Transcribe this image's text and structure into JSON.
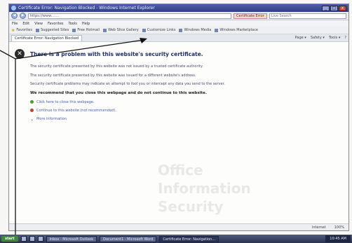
{
  "window": {
    "title": "Certificate Error: Navigation Blocked - Windows Internet Explorer",
    "buttons": {
      "minimize": "_",
      "maximize": "□",
      "close": "x"
    }
  },
  "addressbar": {
    "url": "https://www.……",
    "cert_error": "Certificate Error",
    "search_placeholder": "Live Search"
  },
  "menubar": [
    "File",
    "Edit",
    "View",
    "Favorites",
    "Tools",
    "Help"
  ],
  "favorites_bar": {
    "favorites_label": "Favorites",
    "items": [
      "Suggested Sites",
      "Free Hotmail",
      "Web Slice Gallery",
      "Customize Links",
      "Windows Media",
      "Windows Marketplace"
    ]
  },
  "tabbar": {
    "active_tab": "Certificate Error: Navigation Blocked",
    "commands": [
      "Page ▾",
      "Safety ▾",
      "Tools ▾",
      "?"
    ]
  },
  "content": {
    "headline": "There is a problem with this website's security certificate.",
    "para1": "The security certificate presented by this website was not issued by a trusted certificate authority.",
    "para2": "The security certificate presented by this website was issued for a different website's address.",
    "para3": "Security certificate problems may indicate an attempt to fool you or intercept any data you send to the server.",
    "recommend": "We recommend that you close this webpage and do not continue to this website.",
    "option1": "Click here to close this webpage.",
    "option2": "Continue to this website (not recommended).",
    "option3": "More information"
  },
  "statusbar": {
    "zone": "Internet",
    "zoom": "100%"
  },
  "taskbar": {
    "start": "start",
    "tasks": [
      "Inbox - Microsoft Outlook",
      "Document1 - Microsoft Word",
      "Certificate Error: Navigation..."
    ],
    "clock": "10:45 AM"
  },
  "watermark": [
    "Office",
    "Information",
    "Security"
  ],
  "colors": {
    "headline": "#1f2f6a",
    "link": "#4a5ea8",
    "titlebar": "#2f3f86"
  }
}
